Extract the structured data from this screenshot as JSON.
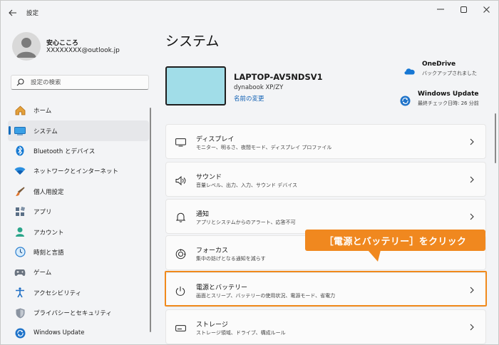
{
  "window": {
    "app_title": "設定"
  },
  "profile": {
    "name": "安心こころ",
    "email": "XXXXXXXX@outlook.jp"
  },
  "search": {
    "placeholder": "設定の検索"
  },
  "sidebar": {
    "items": [
      {
        "label": "ホーム",
        "icon": "home-icon"
      },
      {
        "label": "システム",
        "icon": "system-icon",
        "active": true
      },
      {
        "label": "Bluetooth とデバイス",
        "icon": "bluetooth-icon"
      },
      {
        "label": "ネットワークとインターネット",
        "icon": "wifi-icon"
      },
      {
        "label": "個人用設定",
        "icon": "brush-icon"
      },
      {
        "label": "アプリ",
        "icon": "apps-icon"
      },
      {
        "label": "アカウント",
        "icon": "account-icon"
      },
      {
        "label": "時刻と言語",
        "icon": "clock-globe-icon"
      },
      {
        "label": "ゲーム",
        "icon": "gamepad-icon"
      },
      {
        "label": "アクセシビリティ",
        "icon": "accessibility-icon"
      },
      {
        "label": "プライバシーとセキュリティ",
        "icon": "shield-icon"
      },
      {
        "label": "Windows Update",
        "icon": "windows-update-icon"
      }
    ]
  },
  "main": {
    "title": "システム",
    "device": {
      "name": "LAPTOP-AV5NDSV1",
      "model": "dynabook XP/ZY",
      "rename_link": "名前の変更"
    },
    "onedrive": {
      "title": "OneDrive",
      "sub": "バックアップされました"
    },
    "windows_update": {
      "title": "Windows Update",
      "sub": "最終チェック日時: 26 分前"
    },
    "cards": [
      {
        "title": "ディスプレイ",
        "sub": "モニター、明るさ、夜間モード、ディスプレイ プロファイル",
        "icon": "display-icon"
      },
      {
        "title": "サウンド",
        "sub": "音量レベル、出力、入力、サウンド デバイス",
        "icon": "speaker-icon"
      },
      {
        "title": "通知",
        "sub": "アプリとシステムからのアラート、応答不可",
        "icon": "bell-icon"
      },
      {
        "title": "フォーカス",
        "sub": "集中の妨げとなる通知を減らす",
        "icon": "focus-icon"
      },
      {
        "title": "電源とバッテリー",
        "sub": "画面とスリープ、バッテリーの使用状況、電源モード、省電力",
        "icon": "power-icon"
      },
      {
        "title": "ストレージ",
        "sub": "ストレージ領域、ドライブ、構成ルール",
        "icon": "storage-icon"
      }
    ]
  },
  "annotation": {
    "callout": "［電源とバッテリー］をクリック",
    "color": "#f0881f"
  },
  "colors": {
    "accent": "#0f6cbd",
    "highlight": "#f08a1c"
  }
}
